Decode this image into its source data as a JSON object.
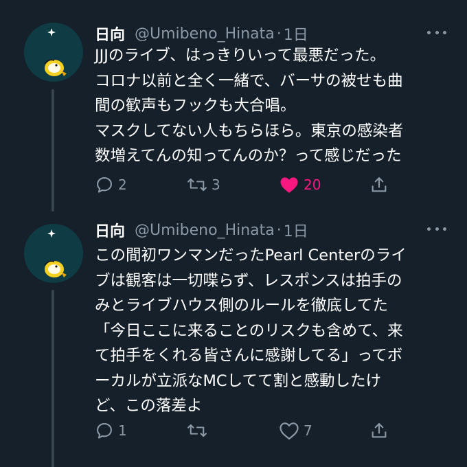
{
  "tweets": [
    {
      "display_name": "日向",
      "handle": "@Umibeno_Hinata",
      "separator": "·",
      "time": "1日",
      "lines": [
        "JJJのライブ、はっきりいって最悪だった。",
        "コロナ以前と全く一緒で、バーサの被せも曲",
        "間の歓声もフックも大合唱。",
        "マスクしてない人もちらほら。東京の感染者",
        "数増えてんの知ってんのか？って感じだった"
      ],
      "reply_count": "2",
      "retweet_count": "3",
      "like_count": "20",
      "liked": true
    },
    {
      "display_name": "日向",
      "handle": "@Umibeno_Hinata",
      "separator": "·",
      "time": "1日",
      "lines": [
        "この間初ワンマンだったPearl Centerのライ",
        "ブは観客は一切喋らず、レスポンスは拍手の",
        "みとライブハウス側のルールを徹底してた",
        "「今日ここに来ることのリスクも含めて、来",
        "て拍手をくれる皆さんに感謝してる」ってボ",
        "ーカルが立派なMCしてて割と感動したけ",
        "ど、この落差よ"
      ],
      "reply_count": "1",
      "retweet_count": "",
      "like_count": "7",
      "liked": false
    }
  ],
  "colors": {
    "background": "#15202b",
    "secondary_text": "#8b98a5",
    "like_active": "#f91880",
    "thread_line": "#38444d"
  },
  "icons": {
    "reply": "speech-bubble-icon",
    "retweet": "retweet-arrows-icon",
    "like": "heart-icon",
    "share": "share-upload-icon",
    "more": "ellipsis-icon"
  }
}
